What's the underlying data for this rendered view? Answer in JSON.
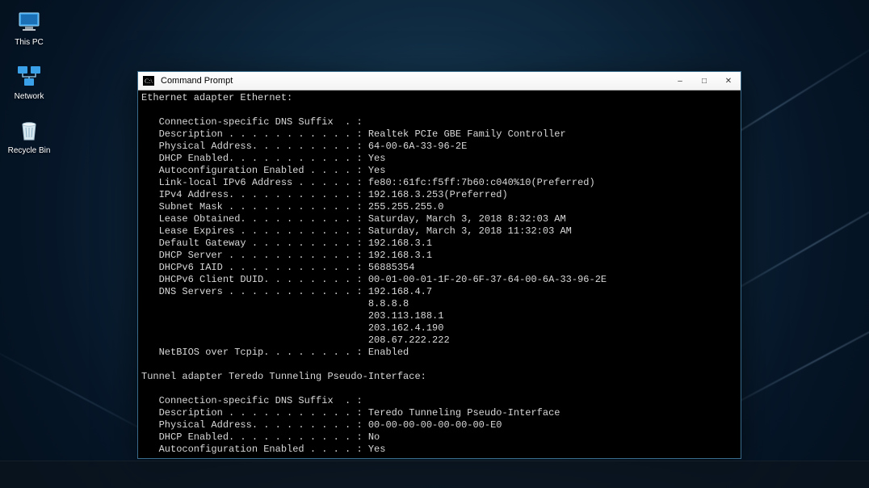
{
  "desktop": {
    "icons": [
      {
        "name": "this-pc",
        "label": "This PC"
      },
      {
        "name": "network",
        "label": "Network"
      },
      {
        "name": "recycle-bin",
        "label": "Recycle Bin"
      }
    ]
  },
  "window": {
    "title": "Command Prompt",
    "buttons": {
      "minimize": "–",
      "maximize": "□",
      "close": "✕"
    }
  },
  "terminal": {
    "section1_header": "Ethernet adapter Ethernet:",
    "s1": {
      "dns_suffix": "   Connection-specific DNS Suffix  . :",
      "description": "   Description . . . . . . . . . . . : Realtek PCIe GBE Family Controller",
      "phys_addr": "   Physical Address. . . . . . . . . : 64-00-6A-33-96-2E",
      "dhcp_enabled": "   DHCP Enabled. . . . . . . . . . . : Yes",
      "autoconf": "   Autoconfiguration Enabled . . . . : Yes",
      "link_local": "   Link-local IPv6 Address . . . . . : fe80::61fc:f5ff:7b60:c040%10(Preferred)",
      "ipv4": "   IPv4 Address. . . . . . . . . . . : 192.168.3.253(Preferred)",
      "subnet": "   Subnet Mask . . . . . . . . . . . : 255.255.255.0",
      "lease_obt": "   Lease Obtained. . . . . . . . . . : Saturday, March 3, 2018 8:32:03 AM",
      "lease_exp": "   Lease Expires . . . . . . . . . . : Saturday, March 3, 2018 11:32:03 AM",
      "gateway": "   Default Gateway . . . . . . . . . : 192.168.3.1",
      "dhcp_server": "   DHCP Server . . . . . . . . . . . : 192.168.3.1",
      "dhcpv6_iaid": "   DHCPv6 IAID . . . . . . . . . . . : 56885354",
      "dhcpv6_duid": "   DHCPv6 Client DUID. . . . . . . . : 00-01-00-01-1F-20-6F-37-64-00-6A-33-96-2E",
      "dns1": "   DNS Servers . . . . . . . . . . . : 192.168.4.7",
      "dns2": "                                       8.8.8.8",
      "dns3": "                                       203.113.188.1",
      "dns4": "                                       203.162.4.190",
      "dns5": "                                       208.67.222.222",
      "netbios": "   NetBIOS over Tcpip. . . . . . . . : Enabled"
    },
    "section2_header": "Tunnel adapter Teredo Tunneling Pseudo-Interface:",
    "s2": {
      "dns_suffix": "   Connection-specific DNS Suffix  . :",
      "description": "   Description . . . . . . . . . . . : Teredo Tunneling Pseudo-Interface",
      "phys_addr": "   Physical Address. . . . . . . . . : 00-00-00-00-00-00-00-E0",
      "dhcp_enabled": "   DHCP Enabled. . . . . . . . . . . : No",
      "autoconf": "   Autoconfiguration Enabled . . . . : Yes"
    }
  }
}
